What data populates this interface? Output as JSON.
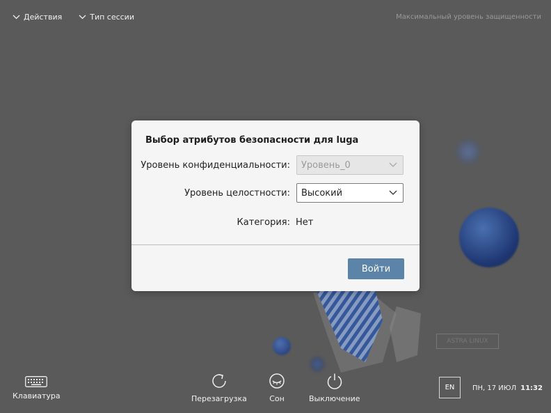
{
  "topbar": {
    "actions_label": "Действия",
    "session_type_label": "Тип сессии",
    "security_level": "Максимальный уровень защищенности"
  },
  "dialog": {
    "title": "Выбор атрибутов безопасности для luga",
    "confidentiality_label": "Уровень конфиденциальности:",
    "confidentiality_value": "Уровень_0",
    "integrity_label": "Уровень целостности:",
    "integrity_value": "Высокий",
    "category_label": "Категория:",
    "category_value": "Нет",
    "login_button": "Войти"
  },
  "bottombar": {
    "keyboard_label": "Клавиатура",
    "restart_label": "Перезагрузка",
    "sleep_label": "Сон",
    "shutdown_label": "Выключение",
    "language": "EN",
    "date": "ПН, 17 ИЮЛ",
    "time": "11:32"
  },
  "colors": {
    "background": "#5a5a5a",
    "dialog_bg": "#f5f5f5",
    "accent_button": "#5c83a8"
  },
  "icons": [
    "chevron-down-icon",
    "keyboard-icon",
    "restart-icon",
    "sleep-icon",
    "power-icon"
  ]
}
